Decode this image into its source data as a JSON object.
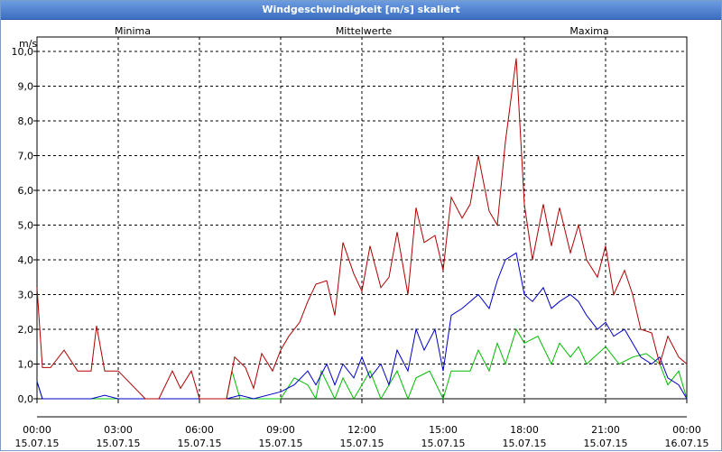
{
  "window": {
    "title": "Windgeschwindigkeit [m/s] skaliert"
  },
  "chart_data": {
    "type": "line",
    "title": "Windgeschwindigkeit [m/s] skaliert",
    "ylabel": "m/s",
    "ylim": [
      0,
      10
    ],
    "xlim_hours": [
      0,
      24
    ],
    "grid": true,
    "legend_placement": "top",
    "y_ticks": [
      "0,0",
      "1,0",
      "2,0",
      "3,0",
      "4,0",
      "5,0",
      "6,0",
      "7,0",
      "8,0",
      "9,0",
      "10,0"
    ],
    "x_ticks": [
      {
        "time": "00:00",
        "date": "15.07.15"
      },
      {
        "time": "03:00",
        "date": "15.07.15"
      },
      {
        "time": "06:00",
        "date": "15.07.15"
      },
      {
        "time": "09:00",
        "date": "15.07.15"
      },
      {
        "time": "12:00",
        "date": "15.07.15"
      },
      {
        "time": "15:00",
        "date": "15.07.15"
      },
      {
        "time": "18:00",
        "date": "15.07.15"
      },
      {
        "time": "21:00",
        "date": "15.07.15"
      },
      {
        "time": "00:00",
        "date": "16.07.15"
      }
    ],
    "series": [
      {
        "name": "Minima",
        "color": "#00bb00",
        "x": [
          0,
          0.2,
          0.5,
          1,
          1.5,
          2,
          2.5,
          3,
          4,
          5,
          6,
          7,
          7.2,
          7.5,
          8,
          9,
          9.5,
          10,
          10.3,
          10.5,
          11,
          11.3,
          11.7,
          12,
          12.3,
          12.7,
          13,
          13.3,
          13.7,
          14,
          14.5,
          15,
          15.3,
          16,
          16.3,
          16.7,
          17,
          17.3,
          17.7,
          18,
          18.5,
          19,
          19.3,
          19.7,
          20,
          20.3,
          21,
          21.5,
          22,
          22.5,
          23,
          23.3,
          23.7,
          24
        ],
        "y": [
          0.5,
          0,
          0,
          0,
          0,
          0,
          0,
          0,
          0,
          0,
          0,
          0,
          0.8,
          0,
          0,
          0,
          0.6,
          0.4,
          0,
          0.8,
          0,
          0.6,
          0,
          0.4,
          0.8,
          0,
          0.4,
          0.8,
          0,
          0.6,
          0.8,
          0,
          0.8,
          0.8,
          1.4,
          0.8,
          1.6,
          1.0,
          2.0,
          1.6,
          1.8,
          1.0,
          1.6,
          1.2,
          1.5,
          1.0,
          1.5,
          1.0,
          1.2,
          1.3,
          1.0,
          0.4,
          0.8,
          0
        ]
      },
      {
        "name": "Mittelwerte",
        "color": "#0000c8",
        "x": [
          0,
          0.2,
          0.5,
          1,
          2,
          2.5,
          3,
          4,
          6,
          7,
          7.5,
          8,
          9,
          9.5,
          10,
          10.3,
          10.7,
          11,
          11.3,
          11.7,
          12,
          12.3,
          12.7,
          13,
          13.3,
          13.7,
          14,
          14.3,
          14.7,
          15,
          15.3,
          15.7,
          16,
          16.3,
          16.7,
          17,
          17.3,
          17.7,
          18,
          18.3,
          18.7,
          19,
          19.3,
          19.7,
          20,
          20.3,
          20.7,
          21,
          21.3,
          21.7,
          22,
          22.3,
          22.7,
          23,
          23.3,
          23.7,
          24
        ],
        "y": [
          0.5,
          0,
          0,
          0,
          0,
          0.1,
          0,
          0,
          0,
          0,
          0.1,
          0,
          0.2,
          0.4,
          0.8,
          0.4,
          1.0,
          0.4,
          1.0,
          0.6,
          1.2,
          0.6,
          1.0,
          0.4,
          1.4,
          0.8,
          2.0,
          1.4,
          2.0,
          0.8,
          2.4,
          2.6,
          2.8,
          3.0,
          2.6,
          3.4,
          4.0,
          4.2,
          3.0,
          2.8,
          3.2,
          2.6,
          2.8,
          3.0,
          2.8,
          2.4,
          2.0,
          2.2,
          1.8,
          2.0,
          1.6,
          1.2,
          1.0,
          1.2,
          0.6,
          0.4,
          0
        ]
      },
      {
        "name": "Maxima",
        "color": "#b00000",
        "x": [
          0,
          0.2,
          0.5,
          1,
          1.5,
          2,
          2.2,
          2.5,
          3,
          4,
          4.5,
          5,
          5.3,
          5.7,
          6,
          6.5,
          7,
          7.3,
          7.7,
          8,
          8.3,
          8.7,
          9,
          9.3,
          9.7,
          10,
          10.3,
          10.7,
          11,
          11.3,
          11.7,
          12,
          12.3,
          12.7,
          13,
          13.3,
          13.7,
          14,
          14.3,
          14.7,
          15,
          15.3,
          15.7,
          16,
          16.3,
          16.7,
          17,
          17.3,
          17.7,
          18,
          18.3,
          18.7,
          19,
          19.3,
          19.7,
          20,
          20.3,
          20.7,
          21,
          21.3,
          21.7,
          22,
          22.3,
          22.7,
          23,
          23.3,
          23.7,
          24
        ],
        "y": [
          3.2,
          0.9,
          0.9,
          1.4,
          0.8,
          0.8,
          2.1,
          0.8,
          0.8,
          0,
          0,
          0.8,
          0.3,
          0.8,
          0,
          0,
          0,
          1.2,
          0.9,
          0.3,
          1.3,
          0.8,
          1.4,
          1.8,
          2.2,
          2.8,
          3.3,
          3.4,
          2.4,
          4.5,
          3.6,
          3.1,
          4.4,
          3.2,
          3.5,
          4.8,
          3.0,
          5.5,
          4.5,
          4.7,
          3.7,
          5.8,
          5.2,
          5.6,
          7.0,
          5.4,
          5.0,
          7.4,
          9.8,
          5.6,
          4.0,
          5.6,
          4.4,
          5.5,
          4.2,
          5.0,
          4.0,
          3.5,
          4.4,
          3.0,
          3.7,
          3.0,
          2.0,
          1.9,
          1.0,
          1.8,
          1.2,
          1.0
        ]
      }
    ]
  }
}
